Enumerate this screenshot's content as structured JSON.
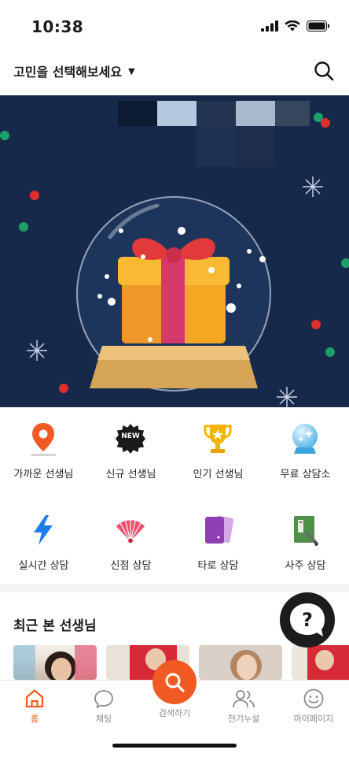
{
  "status_bar": {
    "time": "10:38"
  },
  "header": {
    "title": "고민을 선택해보세요",
    "dropdown_arrow": "▼"
  },
  "categories": [
    {
      "label": "가까운 선생님",
      "icon": "location-pin-icon"
    },
    {
      "label": "신규 선생님",
      "icon": "new-badge-icon",
      "badge_text": "NEW"
    },
    {
      "label": "인기 선생님",
      "icon": "trophy-icon"
    },
    {
      "label": "무료 상담소",
      "icon": "crystal-ball-icon"
    },
    {
      "label": "실시간 상담",
      "icon": "lightning-icon"
    },
    {
      "label": "신점 상담",
      "icon": "fan-icon"
    },
    {
      "label": "타로 상담",
      "icon": "tarot-cards-icon"
    },
    {
      "label": "사주 상담",
      "icon": "saju-book-icon"
    }
  ],
  "recent": {
    "title": "최근 본 선생님"
  },
  "help_button": {
    "label": "?"
  },
  "bottom_nav": [
    {
      "label": "홈",
      "icon": "home-icon",
      "active": true
    },
    {
      "label": "채팅",
      "icon": "chat-icon",
      "active": false
    },
    {
      "label": "검색하기",
      "icon": "search-icon",
      "active": false
    },
    {
      "label": "천기누설",
      "icon": "people-icon",
      "active": false
    },
    {
      "label": "마이페이지",
      "icon": "smile-icon",
      "active": false
    }
  ],
  "colors": {
    "accent": "#f15a22",
    "banner_bg": "#16294a"
  }
}
